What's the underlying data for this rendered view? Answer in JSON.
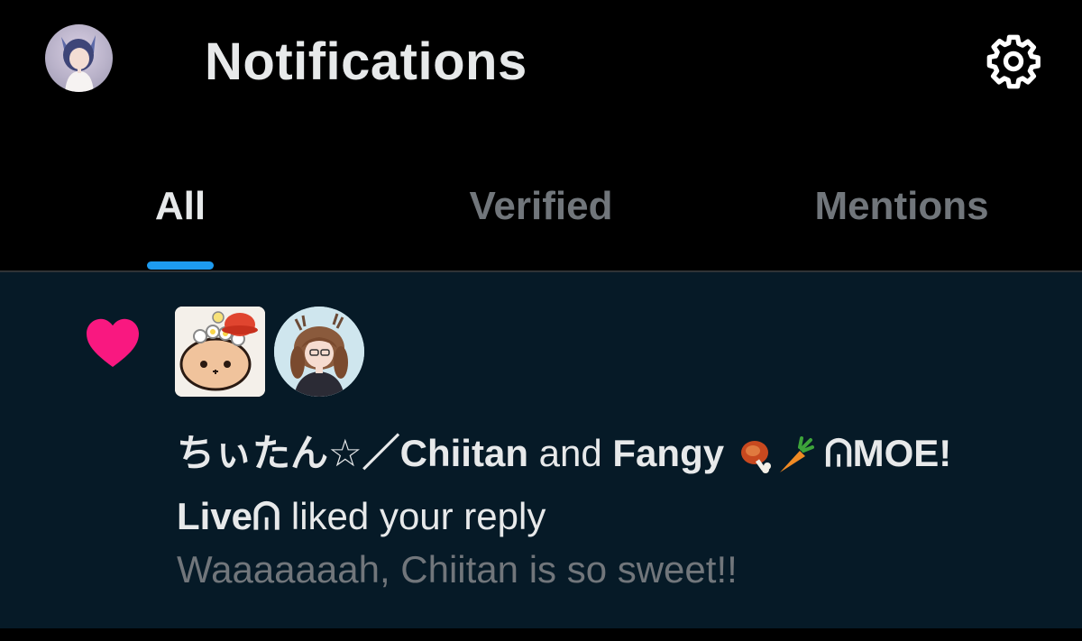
{
  "header": {
    "title": "Notifications",
    "profile_avatar": "profile-avatar-image",
    "settings_icon": "gear-icon"
  },
  "tabs": [
    {
      "label": "All",
      "active": true
    },
    {
      "label": "Verified",
      "active": false
    },
    {
      "label": "Mentions",
      "active": false
    }
  ],
  "notification": {
    "type_icon": "heart-icon",
    "user1": "ちぃたん☆／Chiitan",
    "conjunction": "and",
    "user2_part1": "Fangy",
    "user2_part2": "MOE!",
    "user2_part3": "Live",
    "ribbon": "ᕬ",
    "action": "liked your reply",
    "snippet": "Waaaaaaah, Chiitan is so sweet!!"
  },
  "colors": {
    "background": "#000000",
    "notification_bg": "#061a27",
    "accent": "#1d9bf0",
    "like": "#f91880",
    "text_primary": "#e7e9ea",
    "text_secondary": "#71767b"
  }
}
